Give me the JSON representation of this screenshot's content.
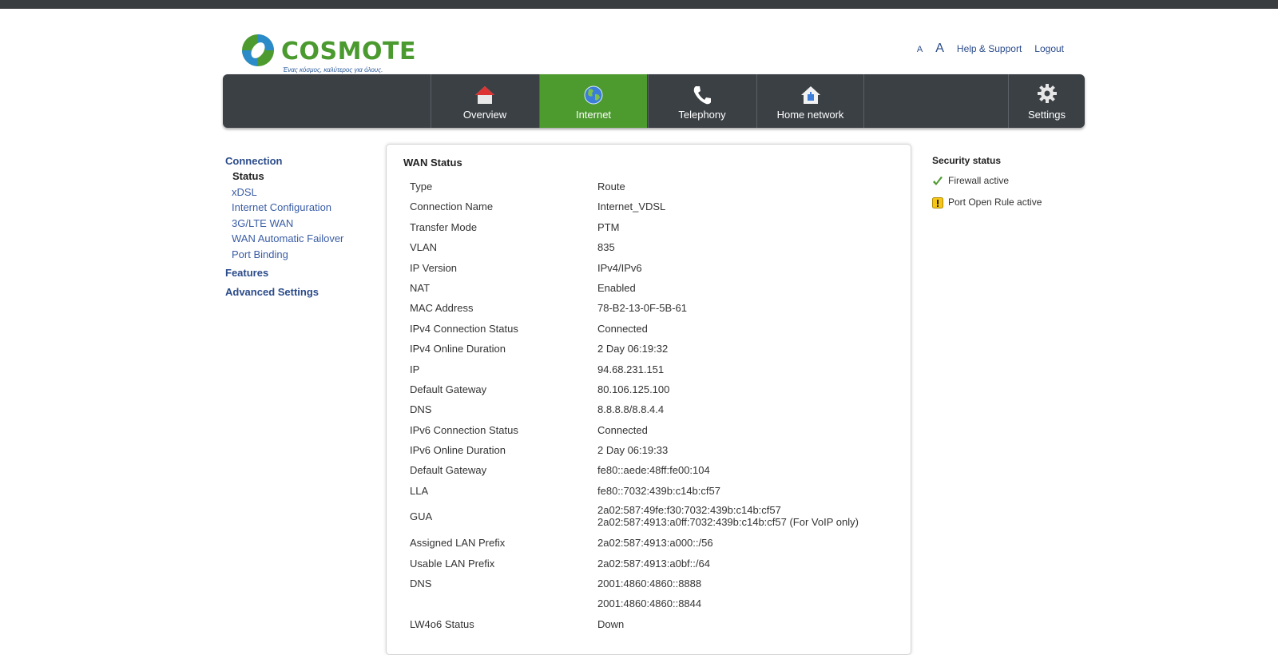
{
  "brand": {
    "name": "COSMOTE",
    "tagline": "Ένας κόσμος, καλύτερος για όλους.",
    "colors": {
      "green": "#4d9a2f",
      "dark": "#3b4045",
      "link": "#2b4b8a"
    }
  },
  "header": {
    "font_small": "A",
    "font_large": "A",
    "help": "Help & Support",
    "logout": "Logout"
  },
  "nav": {
    "items": [
      {
        "label": "Overview",
        "icon": "house-icon"
      },
      {
        "label": "Internet",
        "icon": "globe-icon",
        "active": true
      },
      {
        "label": "Telephony",
        "icon": "phone-icon"
      },
      {
        "label": "Home network",
        "icon": "home-network-icon"
      }
    ],
    "settings": {
      "label": "Settings",
      "icon": "gear-icon"
    }
  },
  "sidebar": {
    "connection": "Connection",
    "sub": [
      "Status",
      "xDSL",
      "Internet Configuration",
      "3G/LTE WAN",
      "WAN Automatic Failover",
      "Port Binding"
    ],
    "features": "Features",
    "advanced": "Advanced Settings"
  },
  "wan": {
    "title": "WAN Status",
    "rows": [
      {
        "k": "Type",
        "v": "Route"
      },
      {
        "k": "Connection Name",
        "v": "Internet_VDSL"
      },
      {
        "k": "Transfer Mode",
        "v": "PTM"
      },
      {
        "k": "VLAN",
        "v": "835"
      },
      {
        "k": "IP Version",
        "v": "IPv4/IPv6"
      },
      {
        "k": "NAT",
        "v": "Enabled"
      },
      {
        "k": "MAC Address",
        "v": "78-B2-13-0F-5B-61"
      },
      {
        "k": "IPv4 Connection Status",
        "v": "Connected"
      },
      {
        "k": "IPv4 Online Duration",
        "v": "2 Day 06:19:32"
      },
      {
        "k": "IP",
        "v": "94.68.231.151"
      },
      {
        "k": "Default Gateway",
        "v": "80.106.125.100"
      },
      {
        "k": "DNS",
        "v": "8.8.8.8/8.8.4.4"
      },
      {
        "k": "IPv6 Connection Status",
        "v": "Connected"
      },
      {
        "k": "IPv6 Online Duration",
        "v": "2 Day 06:19:33"
      },
      {
        "k": "Default Gateway",
        "v": "fe80::aede:48ff:fe00:104"
      },
      {
        "k": "LLA",
        "v": "fe80::7032:439b:c14b:cf57"
      }
    ],
    "gua": {
      "k": "GUA",
      "v1": "2a02:587:49fe:f30:7032:439b:c14b:cf57",
      "v2": "2a02:587:4913:a0ff:7032:439b:c14b:cf57 (For VoIP only)"
    },
    "rows2": [
      {
        "k": "Assigned LAN Prefix",
        "v": "2a02:587:4913:a000::/56"
      },
      {
        "k": "Usable LAN Prefix",
        "v": "2a02:587:4913:a0bf::/64"
      },
      {
        "k": "DNS",
        "v": "2001:4860:4860::8888"
      },
      {
        "k": "",
        "v": "2001:4860:4860::8844"
      },
      {
        "k": "LW4o6 Status",
        "v": "Down"
      }
    ]
  },
  "security": {
    "title": "Security status",
    "items": [
      {
        "label": "Firewall active",
        "icon": "check-icon"
      },
      {
        "label": "Port Open Rule active",
        "icon": "warning-icon"
      }
    ]
  }
}
